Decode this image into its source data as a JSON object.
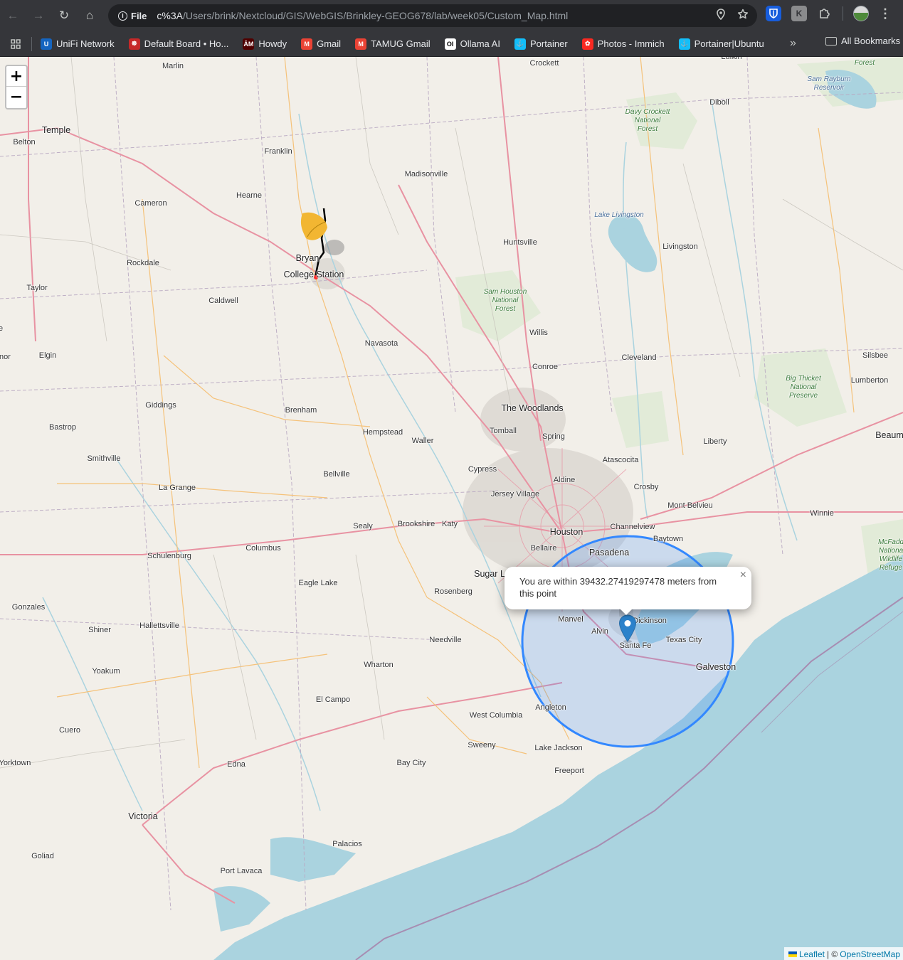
{
  "browser": {
    "nav": {
      "back": "←",
      "forward": "→",
      "reload": "↻",
      "home": "⌂"
    },
    "site_chip": "File",
    "url_prefix": "c%3A",
    "url_path": "/Users/brink/Nextcloud/GIS/WebGIS/Brinkley-GEOG678/lab/week05/Custom_Map.html",
    "omni_icons": {
      "location": "location-pin-icon",
      "bookmark": "star-icon"
    },
    "extensions": [
      {
        "name": "bitwarden-icon",
        "glyph": "⛉"
      },
      {
        "name": "extension-k-icon",
        "glyph": "K"
      },
      {
        "name": "puzzle-icon",
        "glyph": "⧉"
      }
    ],
    "menu": "⋮"
  },
  "bookmarks": {
    "items": [
      {
        "label": "UniFi Network",
        "icon": "unifi-icon",
        "color": "#1565c0",
        "glyph": "U"
      },
      {
        "label": "Default Board • Ho...",
        "icon": "homeassistant-icon",
        "color": "#c62828",
        "glyph": "☸"
      },
      {
        "label": "Howdy",
        "icon": "tamu-icon",
        "color": "#500000",
        "glyph": "ĀM"
      },
      {
        "label": "Gmail",
        "icon": "gmail-icon",
        "color": "#ea4335",
        "glyph": "M"
      },
      {
        "label": "TAMUG Gmail",
        "icon": "gmail-icon",
        "color": "#ea4335",
        "glyph": "M"
      },
      {
        "label": "Ollama AI",
        "icon": "ollama-icon",
        "color": "#ffffff",
        "glyph": "OI"
      },
      {
        "label": "Portainer",
        "icon": "portainer-icon",
        "color": "#13bef9",
        "glyph": "⚓"
      },
      {
        "label": "Photos - Immich",
        "icon": "immich-icon",
        "color": "#fa2921",
        "glyph": "✿"
      },
      {
        "label": "Portainer|Ubuntu",
        "icon": "portainer-icon",
        "color": "#13bef9",
        "glyph": "⚓"
      }
    ],
    "more": "»",
    "all_label": "All Bookmarks"
  },
  "map": {
    "zoom_in": "+",
    "zoom_out": "−",
    "popup_text": "You are within 39432.27419297478 meters from this point",
    "popup_close": "×",
    "attribution": {
      "leaflet": "Leaflet",
      "sep": "| ©",
      "osm": "OpenStreetMap"
    },
    "accuracy_circle_color": "#3388ff",
    "places": [
      {
        "name": "Crockett",
        "cls": ""
      },
      {
        "name": "Lufkin",
        "cls": ""
      },
      {
        "name": "Diboll",
        "cls": ""
      },
      {
        "name": "Marlin",
        "cls": ""
      },
      {
        "name": "Temple",
        "cls": "big"
      },
      {
        "name": "Belton",
        "cls": ""
      },
      {
        "name": "Franklin",
        "cls": ""
      },
      {
        "name": "Madisonville",
        "cls": ""
      },
      {
        "name": "Hearne",
        "cls": ""
      },
      {
        "name": "Cameron",
        "cls": ""
      },
      {
        "name": "Bryan",
        "cls": "big"
      },
      {
        "name": "College Station",
        "cls": "big"
      },
      {
        "name": "Rockdale",
        "cls": ""
      },
      {
        "name": "Huntsville",
        "cls": ""
      },
      {
        "name": "Livingston",
        "cls": ""
      },
      {
        "name": "Taylor",
        "cls": ""
      },
      {
        "name": "Caldwell",
        "cls": ""
      },
      {
        "name": "Willis",
        "cls": ""
      },
      {
        "name": "Navasota",
        "cls": ""
      },
      {
        "name": "Elgin",
        "cls": ""
      },
      {
        "name": "Conroe",
        "cls": ""
      },
      {
        "name": "Cleveland",
        "cls": ""
      },
      {
        "name": "Silsbee",
        "cls": ""
      },
      {
        "name": "Lumberton",
        "cls": ""
      },
      {
        "name": "Giddings",
        "cls": ""
      },
      {
        "name": "Brenham",
        "cls": ""
      },
      {
        "name": "The Woodlands",
        "cls": "big"
      },
      {
        "name": "Bastrop",
        "cls": ""
      },
      {
        "name": "Hempstead",
        "cls": ""
      },
      {
        "name": "Tomball",
        "cls": ""
      },
      {
        "name": "Waller",
        "cls": ""
      },
      {
        "name": "Spring",
        "cls": ""
      },
      {
        "name": "Liberty",
        "cls": ""
      },
      {
        "name": "Beaum",
        "cls": "big"
      },
      {
        "name": "Smithville",
        "cls": ""
      },
      {
        "name": "Cypress",
        "cls": ""
      },
      {
        "name": "Atascocita",
        "cls": ""
      },
      {
        "name": "Bellville",
        "cls": ""
      },
      {
        "name": "Aldine",
        "cls": ""
      },
      {
        "name": "La Grange",
        "cls": ""
      },
      {
        "name": "Crosby",
        "cls": ""
      },
      {
        "name": "Jersey Village",
        "cls": ""
      },
      {
        "name": "Mont Belvieu",
        "cls": ""
      },
      {
        "name": "Winnie",
        "cls": ""
      },
      {
        "name": "Sealy",
        "cls": ""
      },
      {
        "name": "Brookshire",
        "cls": ""
      },
      {
        "name": "Katy",
        "cls": ""
      },
      {
        "name": "Houston",
        "cls": "big"
      },
      {
        "name": "Channelview",
        "cls": ""
      },
      {
        "name": "Schulenburg",
        "cls": ""
      },
      {
        "name": "Columbus",
        "cls": ""
      },
      {
        "name": "Bellaire",
        "cls": ""
      },
      {
        "name": "Pasadena",
        "cls": "big"
      },
      {
        "name": "Baytown",
        "cls": ""
      },
      {
        "name": "Sugar L",
        "cls": "big"
      },
      {
        "name": "Eagle Lake",
        "cls": ""
      },
      {
        "name": "Rosenberg",
        "cls": ""
      },
      {
        "name": "Gonzales",
        "cls": ""
      },
      {
        "name": "Manvel",
        "cls": ""
      },
      {
        "name": "Dickinson",
        "cls": ""
      },
      {
        "name": "Hallettsville",
        "cls": ""
      },
      {
        "name": "Shiner",
        "cls": ""
      },
      {
        "name": "Alvin",
        "cls": ""
      },
      {
        "name": "Needville",
        "cls": ""
      },
      {
        "name": "Texas City",
        "cls": ""
      },
      {
        "name": "Santa Fe",
        "cls": ""
      },
      {
        "name": "Galveston",
        "cls": "big"
      },
      {
        "name": "Wharton",
        "cls": ""
      },
      {
        "name": "Yoakum",
        "cls": ""
      },
      {
        "name": "El Campo",
        "cls": ""
      },
      {
        "name": "Angleton",
        "cls": ""
      },
      {
        "name": "West Columbia",
        "cls": ""
      },
      {
        "name": "Cuero",
        "cls": ""
      },
      {
        "name": "Sweeny",
        "cls": ""
      },
      {
        "name": "Lake Jackson",
        "cls": ""
      },
      {
        "name": "Yorktown",
        "cls": ""
      },
      {
        "name": "Edna",
        "cls": ""
      },
      {
        "name": "Bay City",
        "cls": ""
      },
      {
        "name": "Freeport",
        "cls": ""
      },
      {
        "name": "Victoria",
        "cls": "big"
      },
      {
        "name": "Goliad",
        "cls": ""
      },
      {
        "name": "Palacios",
        "cls": ""
      },
      {
        "name": "Port Lavaca",
        "cls": ""
      },
      {
        "name": "nor",
        "cls": ""
      },
      {
        "name": "e",
        "cls": ""
      }
    ],
    "parks": [
      {
        "name": "Davy Crockett\nNational\nForest",
        "cls": "park"
      },
      {
        "name": "Sam Houston\nNational\nForest",
        "cls": "park"
      },
      {
        "name": "Big Thicket\nNational\nPreserve",
        "cls": "park"
      },
      {
        "name": "Forest",
        "cls": "park"
      },
      {
        "name": "McFadd\nNationa\nWildlife\nRefuge",
        "cls": "park"
      },
      {
        "name": "Lake Livingston",
        "cls": "water"
      },
      {
        "name": "Sam Rayburn\nReservoir",
        "cls": "water"
      }
    ]
  }
}
